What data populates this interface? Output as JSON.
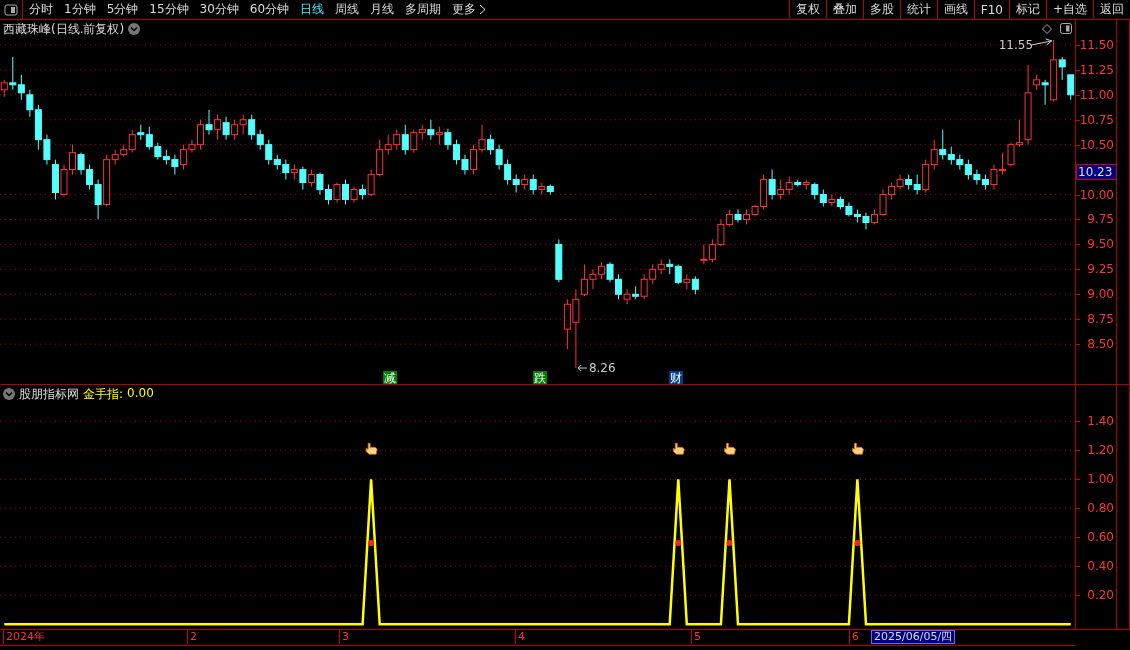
{
  "toolbar": {
    "periods": [
      {
        "label": "分时",
        "selected": false
      },
      {
        "label": "1分钟",
        "selected": false
      },
      {
        "label": "5分钟",
        "selected": false
      },
      {
        "label": "15分钟",
        "selected": false
      },
      {
        "label": "30分钟",
        "selected": false
      },
      {
        "label": "60分钟",
        "selected": false
      },
      {
        "label": "日线",
        "selected": true
      },
      {
        "label": "周线",
        "selected": false
      },
      {
        "label": "月线",
        "selected": false
      },
      {
        "label": "多周期",
        "selected": false
      },
      {
        "label": "更多",
        "selected": false,
        "kind": "more"
      }
    ],
    "buttons": [
      "复权",
      "叠加",
      "多股",
      "统计",
      "画线",
      "F10",
      "标记",
      "+自选",
      "返回"
    ]
  },
  "price_chart": {
    "title": "西藏珠峰(日线.前复权)",
    "high_label": "11.55",
    "low_label": "8.26",
    "current_price": "10.23",
    "events": [
      {
        "label": "减",
        "color": "#008000"
      },
      {
        "label": "跌",
        "color": "#008000"
      },
      {
        "label": "财",
        "color": "#003c8c"
      }
    ],
    "chart_data": {
      "type": "candlestick",
      "ylim": [
        8.09,
        11.75
      ],
      "grid": true,
      "categories": [
        null,
        null,
        null,
        null,
        null,
        null,
        null,
        null,
        null,
        null,
        null,
        null,
        null,
        null,
        null,
        null,
        null,
        null,
        null,
        null,
        null,
        null,
        null,
        null,
        null,
        null,
        null,
        null,
        null,
        null,
        null,
        null,
        null,
        null,
        null,
        null,
        null,
        null,
        null,
        null,
        null,
        null,
        null,
        null,
        null,
        null,
        null,
        null,
        null,
        null,
        null,
        null,
        null,
        null,
        null,
        null,
        null,
        null,
        null,
        null,
        null,
        null,
        null,
        null,
        null,
        null,
        null,
        null,
        null,
        null,
        null,
        null,
        null,
        null,
        null,
        null,
        null,
        null,
        null,
        null,
        null,
        null,
        null,
        null,
        null,
        null,
        null,
        null,
        null,
        null,
        null,
        null,
        null,
        null,
        null,
        null,
        null,
        null,
        null,
        null,
        null,
        null,
        null,
        null,
        null,
        null,
        null,
        null,
        null,
        null,
        null,
        null,
        null,
        null,
        null,
        null,
        null,
        null,
        null,
        null,
        null,
        null,
        null,
        null,
        null,
        null
      ],
      "ohlc": [
        [
          11.05,
          11.15,
          10.98,
          11.12
        ],
        [
          11.12,
          11.38,
          11.05,
          11.1
        ],
        [
          11.1,
          11.2,
          10.95,
          11.02
        ],
        [
          11.0,
          11.05,
          10.78,
          10.85
        ],
        [
          10.85,
          10.9,
          10.45,
          10.55
        ],
        [
          10.55,
          10.6,
          10.3,
          10.35
        ],
        [
          10.3,
          10.35,
          9.95,
          10.02
        ],
        [
          10.0,
          10.3,
          9.98,
          10.25
        ],
        [
          10.25,
          10.5,
          10.2,
          10.42
        ],
        [
          10.4,
          10.42,
          10.2,
          10.25
        ],
        [
          10.25,
          10.3,
          10.05,
          10.1
        ],
        [
          10.1,
          10.15,
          9.75,
          9.9
        ],
        [
          9.9,
          10.4,
          9.88,
          10.35
        ],
        [
          10.35,
          10.45,
          10.3,
          10.4
        ],
        [
          10.4,
          10.5,
          10.38,
          10.45
        ],
        [
          10.45,
          10.65,
          10.42,
          10.6
        ],
        [
          10.62,
          10.7,
          10.55,
          10.6
        ],
        [
          10.6,
          10.68,
          10.45,
          10.48
        ],
        [
          10.48,
          10.52,
          10.35,
          10.38
        ],
        [
          10.38,
          10.45,
          10.3,
          10.35
        ],
        [
          10.35,
          10.4,
          10.2,
          10.28
        ],
        [
          10.3,
          10.5,
          10.25,
          10.45
        ],
        [
          10.45,
          10.55,
          10.42,
          10.5
        ],
        [
          10.5,
          10.75,
          10.45,
          10.7
        ],
        [
          10.7,
          10.85,
          10.6,
          10.65
        ],
        [
          10.65,
          10.8,
          10.55,
          10.75
        ],
        [
          10.72,
          10.78,
          10.55,
          10.6
        ],
        [
          10.6,
          10.75,
          10.55,
          10.7
        ],
        [
          10.7,
          10.8,
          10.6,
          10.75
        ],
        [
          10.75,
          10.8,
          10.55,
          10.6
        ],
        [
          10.6,
          10.65,
          10.45,
          10.5
        ],
        [
          10.5,
          10.55,
          10.3,
          10.35
        ],
        [
          10.35,
          10.4,
          10.25,
          10.3
        ],
        [
          10.3,
          10.35,
          10.15,
          10.22
        ],
        [
          10.22,
          10.3,
          10.15,
          10.25
        ],
        [
          10.25,
          10.28,
          10.05,
          10.12
        ],
        [
          10.12,
          10.25,
          10.08,
          10.2
        ],
        [
          10.2,
          10.22,
          10.0,
          10.05
        ],
        [
          10.05,
          10.1,
          9.9,
          9.95
        ],
        [
          9.95,
          10.12,
          9.92,
          10.1
        ],
        [
          10.1,
          10.15,
          9.9,
          9.95
        ],
        [
          9.95,
          10.08,
          9.92,
          10.05
        ],
        [
          10.05,
          10.1,
          9.95,
          10.0
        ],
        [
          10.0,
          10.25,
          9.98,
          10.2
        ],
        [
          10.2,
          10.55,
          10.18,
          10.45
        ],
        [
          10.45,
          10.6,
          10.4,
          10.5
        ],
        [
          10.5,
          10.65,
          10.45,
          10.6
        ],
        [
          10.6,
          10.7,
          10.4,
          10.45
        ],
        [
          10.45,
          10.65,
          10.42,
          10.62
        ],
        [
          10.62,
          10.7,
          10.55,
          10.65
        ],
        [
          10.65,
          10.75,
          10.55,
          10.6
        ],
        [
          10.6,
          10.68,
          10.5,
          10.62
        ],
        [
          10.62,
          10.66,
          10.45,
          10.5
        ],
        [
          10.5,
          10.55,
          10.3,
          10.35
        ],
        [
          10.35,
          10.4,
          10.2,
          10.25
        ],
        [
          10.25,
          10.5,
          10.2,
          10.45
        ],
        [
          10.45,
          10.7,
          10.42,
          10.55
        ],
        [
          10.55,
          10.6,
          10.4,
          10.45
        ],
        [
          10.45,
          10.5,
          10.25,
          10.3
        ],
        [
          10.3,
          10.35,
          10.1,
          10.15
        ],
        [
          10.15,
          10.2,
          10.02,
          10.1
        ],
        [
          10.1,
          10.2,
          10.05,
          10.15
        ],
        [
          10.15,
          10.2,
          10.0,
          10.05
        ],
        [
          10.05,
          10.12,
          10.0,
          10.08
        ],
        [
          10.08,
          10.1,
          10.0,
          10.03
        ],
        [
          9.5,
          9.55,
          9.12,
          9.15
        ],
        [
          8.65,
          8.95,
          8.45,
          8.9
        ],
        [
          8.72,
          9.05,
          8.26,
          8.95
        ],
        [
          9.0,
          9.3,
          8.98,
          9.15
        ],
        [
          9.15,
          9.25,
          9.05,
          9.2
        ],
        [
          9.2,
          9.32,
          9.15,
          9.28
        ],
        [
          9.3,
          9.32,
          9.12,
          9.15
        ],
        [
          9.15,
          9.2,
          8.95,
          9.0
        ],
        [
          8.95,
          9.05,
          8.9,
          9.0
        ],
        [
          9.0,
          9.08,
          8.95,
          8.98
        ],
        [
          8.98,
          9.2,
          8.95,
          9.15
        ],
        [
          9.15,
          9.3,
          9.1,
          9.25
        ],
        [
          9.25,
          9.35,
          9.2,
          9.3
        ],
        [
          9.3,
          9.35,
          9.2,
          9.28
        ],
        [
          9.28,
          9.3,
          9.1,
          9.12
        ],
        [
          9.12,
          9.2,
          9.05,
          9.15
        ],
        [
          9.15,
          9.18,
          9.0,
          9.05
        ],
        [
          9.35,
          9.5,
          9.3,
          9.35
        ],
        [
          9.35,
          9.55,
          9.32,
          9.5
        ],
        [
          9.5,
          9.75,
          9.48,
          9.7
        ],
        [
          9.7,
          9.85,
          9.68,
          9.8
        ],
        [
          9.8,
          9.85,
          9.72,
          9.75
        ],
        [
          9.75,
          9.85,
          9.7,
          9.8
        ],
        [
          9.8,
          9.9,
          9.78,
          9.88
        ],
        [
          9.88,
          10.2,
          9.85,
          10.15
        ],
        [
          10.15,
          10.25,
          9.95,
          10.0
        ],
        [
          10.0,
          10.15,
          9.95,
          10.05
        ],
        [
          10.05,
          10.18,
          10.0,
          10.12
        ],
        [
          10.12,
          10.15,
          10.08,
          10.1
        ],
        [
          10.1,
          10.15,
          10.05,
          10.12
        ],
        [
          10.1,
          10.12,
          9.95,
          10.0
        ],
        [
          10.0,
          10.05,
          9.88,
          9.92
        ],
        [
          9.92,
          10.0,
          9.88,
          9.95
        ],
        [
          9.95,
          9.98,
          9.85,
          9.88
        ],
        [
          9.88,
          9.92,
          9.78,
          9.8
        ],
        [
          9.8,
          9.85,
          9.72,
          9.78
        ],
        [
          9.78,
          9.82,
          9.65,
          9.72
        ],
        [
          9.72,
          9.85,
          9.7,
          9.8
        ],
        [
          9.8,
          10.05,
          9.78,
          10.0
        ],
        [
          10.0,
          10.12,
          9.95,
          10.08
        ],
        [
          10.08,
          10.2,
          10.05,
          10.15
        ],
        [
          10.15,
          10.2,
          10.05,
          10.1
        ],
        [
          10.1,
          10.2,
          10.0,
          10.05
        ],
        [
          10.05,
          10.35,
          10.02,
          10.3
        ],
        [
          10.3,
          10.55,
          10.25,
          10.45
        ],
        [
          10.45,
          10.65,
          10.35,
          10.4
        ],
        [
          10.4,
          10.48,
          10.3,
          10.35
        ],
        [
          10.35,
          10.4,
          10.25,
          10.3
        ],
        [
          10.3,
          10.35,
          10.15,
          10.2
        ],
        [
          10.2,
          10.25,
          10.1,
          10.15
        ],
        [
          10.15,
          10.2,
          10.05,
          10.1
        ],
        [
          10.1,
          10.3,
          10.05,
          10.25
        ],
        [
          10.25,
          10.42,
          10.2,
          10.25
        ],
        [
          10.3,
          10.52,
          10.28,
          10.5
        ],
        [
          10.5,
          10.75,
          10.48,
          10.52
        ],
        [
          10.55,
          11.3,
          10.5,
          11.02
        ],
        [
          11.1,
          11.2,
          11.05,
          11.15
        ],
        [
          11.12,
          11.15,
          10.9,
          11.1
        ],
        [
          10.95,
          11.55,
          10.93,
          11.35
        ],
        [
          11.35,
          11.38,
          11.15,
          11.28
        ],
        [
          11.2,
          11.2,
          10.95,
          11.0
        ]
      ],
      "yticks": [
        {
          "value": 11.5,
          "label": "11.50"
        },
        {
          "value": 11.25,
          "label": "11.25"
        },
        {
          "value": 11,
          "label": "11.00"
        },
        {
          "value": 10.75,
          "label": "10.75"
        },
        {
          "value": 10.5,
          "label": "10.50"
        },
        {
          "value": 10,
          "label": "10.00"
        },
        {
          "value": 9.75,
          "label": "9.75"
        },
        {
          "value": 9.5,
          "label": "9.50"
        },
        {
          "value": 9.25,
          "label": "9.25"
        },
        {
          "value": 9,
          "label": "9.00"
        },
        {
          "value": 8.75,
          "label": "8.75"
        },
        {
          "value": 8.5,
          "label": "8.50"
        }
      ]
    }
  },
  "indicator": {
    "name": "股朋指标网",
    "reading": "0.00",
    "chart_data": {
      "type": "line",
      "grid": true,
      "categories": [
        null,
        null,
        null,
        null,
        null,
        null,
        null,
        null,
        null,
        null,
        null,
        null,
        null,
        null,
        null,
        null,
        null,
        null,
        null,
        null,
        null,
        null,
        null,
        null,
        null,
        null,
        null,
        null,
        null,
        null,
        null,
        null,
        null,
        null,
        null,
        null,
        null,
        null,
        null,
        null,
        null,
        null,
        null,
        null,
        null,
        null,
        null,
        null,
        null,
        null,
        null,
        null,
        null,
        null,
        null,
        null,
        null,
        null,
        null,
        null,
        null,
        null,
        null,
        null,
        null,
        null,
        null,
        null,
        null,
        null,
        null,
        null,
        null,
        null,
        null,
        null,
        null,
        null,
        null,
        null,
        null,
        null,
        null,
        null,
        null,
        null,
        null,
        null,
        null,
        null,
        null,
        null,
        null,
        null,
        null,
        null,
        null,
        null,
        null,
        null,
        null,
        null,
        null,
        null,
        null,
        null,
        null,
        null,
        null,
        null,
        null,
        null,
        null,
        null,
        null,
        null,
        null,
        null,
        null,
        null,
        null,
        null,
        null,
        null,
        null,
        null
      ],
      "series": [
        {
          "name": "金手指:",
          "color": "#ffff00",
          "values": [
            0,
            0,
            0,
            0,
            0,
            0,
            0,
            0,
            0,
            0,
            0,
            0,
            0,
            0,
            0,
            0,
            0,
            0,
            0,
            0,
            0,
            0,
            0,
            0,
            0,
            0,
            0,
            0,
            0,
            0,
            0,
            0,
            0,
            0,
            0,
            0,
            0,
            0,
            0,
            0,
            0,
            0,
            0,
            1,
            0,
            0,
            0,
            0,
            0,
            0,
            0,
            0,
            0,
            0,
            0,
            0,
            0,
            0,
            0,
            0,
            0,
            0,
            0,
            0,
            0,
            0,
            0,
            0,
            0,
            0,
            0,
            0,
            0,
            0,
            0,
            0,
            0,
            0,
            0,
            1,
            0,
            0,
            0,
            0,
            0,
            1,
            0,
            0,
            0,
            0,
            0,
            0,
            0,
            0,
            0,
            0,
            0,
            0,
            0,
            0,
            1,
            0,
            0,
            0,
            0,
            0,
            0,
            0,
            0,
            0,
            0,
            0,
            0,
            0,
            0,
            0,
            0,
            0,
            0,
            0,
            0,
            0,
            0,
            0,
            0,
            0
          ]
        }
      ],
      "ylim": [
        -0.04,
        1.65
      ],
      "yticks": [
        {
          "value": 1.4,
          "label": "1.40"
        },
        {
          "value": 1.2,
          "label": "1.20"
        },
        {
          "value": 1,
          "label": "1.00"
        },
        {
          "value": 0.8,
          "label": "0.80"
        },
        {
          "value": 0.6,
          "label": "0.60"
        },
        {
          "value": 0.4,
          "label": "0.40"
        },
        {
          "value": 0.2,
          "label": "0.20"
        }
      ]
    }
  },
  "time_axis": {
    "labels": [
      "2024年",
      "2",
      "3",
      "4",
      "5",
      "6"
    ],
    "cursor_date": "2025/06/05/四"
  }
}
